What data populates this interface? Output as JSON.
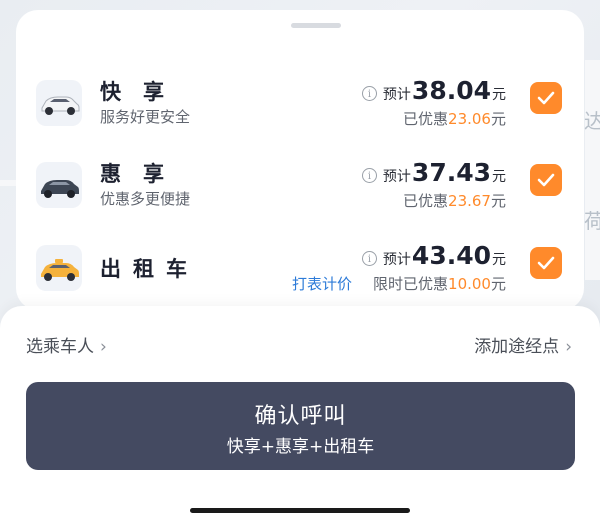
{
  "options": [
    {
      "name": "快享",
      "subtitle": "服务好更安全",
      "estimate_label": "预计",
      "price": "38.04",
      "unit": "元",
      "discount_prefix": "已优惠",
      "discount": "23.06",
      "discount_unit": "元",
      "checked": true
    },
    {
      "name": "惠享",
      "subtitle": "优惠多更便捷",
      "estimate_label": "预计",
      "price": "37.43",
      "unit": "元",
      "discount_prefix": "已优惠",
      "discount": "23.67",
      "discount_unit": "元",
      "checked": true
    },
    {
      "name": "出租车",
      "meter_label": "打表计价",
      "estimate_label": "预计",
      "price": "43.40",
      "unit": "元",
      "discount_prefix": "限时已优惠",
      "discount": "10.00",
      "discount_unit": "元",
      "checked": true
    }
  ],
  "info_glyph": "i",
  "footer": {
    "select_passenger": "选乘车人",
    "add_waypoint": "添加途经点",
    "chevron": "›",
    "confirm_label": "确认呼叫",
    "confirm_sub": "快享+惠享+出租车"
  },
  "colors": {
    "accent": "#ff8a2b",
    "link": "#2d7bd8",
    "confirm_bg": "#444a61"
  },
  "icons": {
    "check": "check-icon",
    "info": "info-icon",
    "chevron": "chevron-right-icon"
  }
}
